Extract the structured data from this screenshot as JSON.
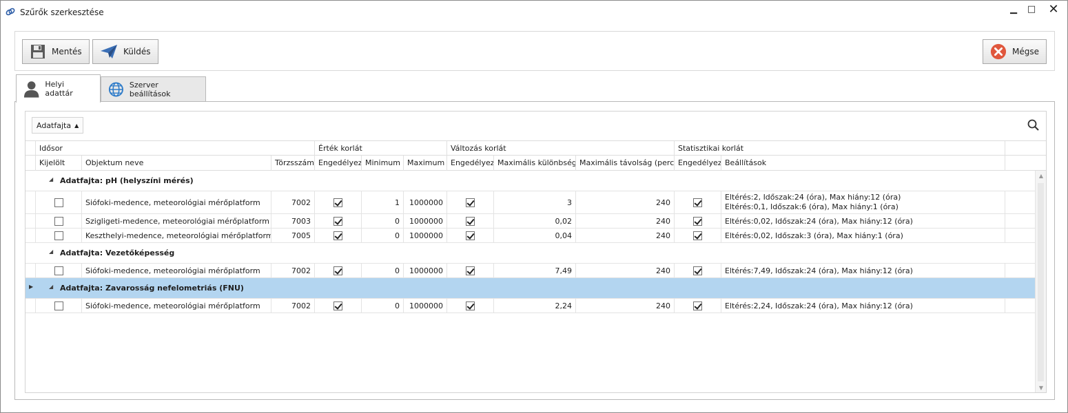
{
  "window": {
    "title": "Szűrők szerkesztése",
    "icons": {
      "app": "filter-chain-icon",
      "minimize": "minimize-icon",
      "maximize": "maximize-icon",
      "close": "close-icon"
    }
  },
  "toolbar": {
    "save_label": "Mentés",
    "send_label": "Küldés",
    "cancel_label": "Mégse",
    "icons": {
      "save": "floppy-disk-icon",
      "send": "paper-plane-icon",
      "cancel": "cancel-x-icon"
    }
  },
  "tabs": [
    {
      "label": "Helyi adattár",
      "icon": "user-icon",
      "active": true
    },
    {
      "label": "Szerver beállítások",
      "icon": "globe-icon",
      "active": false
    }
  ],
  "grid": {
    "group_chip": "Adatfajta",
    "band_headers": {
      "series": "Idősor",
      "value_limit": "Érték korlát",
      "change_limit": "Változás korlát",
      "stat_limit": "Statisztikai korlát"
    },
    "columns": {
      "selected": "Kijelölt",
      "object_name": "Objektum neve",
      "station_id": "Törzsszám",
      "value_enabled": "Engedélyez",
      "minimum": "Minimum",
      "maximum": "Maximum",
      "change_enabled": "Engedélyez",
      "max_diff": "Maximális különbség",
      "max_dist": "Maximális távolság (perc)",
      "stat_enabled": "Engedélyez",
      "settings": "Beállítások"
    },
    "groups": [
      {
        "label": "Adatfajta: pH (helyszíni mérés)",
        "selected": false,
        "rows": [
          {
            "selected": false,
            "object_name": "Siófoki-medence, meteorológiai mérőplatform",
            "station_id": "7002",
            "value_enabled": true,
            "minimum": "1",
            "maximum": "1000000",
            "change_enabled": true,
            "max_diff": "3",
            "max_dist": "240",
            "stat_enabled": true,
            "settings": [
              "Eltérés:2, Időszak:24 (óra), Max hiány:12 (óra)",
              "Eltérés:0,1, Időszak:6 (óra), Max hiány:1 (óra)"
            ]
          },
          {
            "selected": false,
            "object_name": "Szigligeti-medence, meteorológiai mérőplatform",
            "station_id": "7003",
            "value_enabled": true,
            "minimum": "0",
            "maximum": "1000000",
            "change_enabled": true,
            "max_diff": "0,02",
            "max_dist": "240",
            "stat_enabled": true,
            "settings": [
              "Eltérés:0,02, Időszak:24 (óra), Max hiány:12 (óra)"
            ]
          },
          {
            "selected": false,
            "object_name": "Keszthelyi-medence, meteorológiai mérőplatform",
            "station_id": "7005",
            "value_enabled": true,
            "minimum": "0",
            "maximum": "1000000",
            "change_enabled": true,
            "max_diff": "0,04",
            "max_dist": "240",
            "stat_enabled": true,
            "settings": [
              "Eltérés:0,02, Időszak:3 (óra), Max hiány:1 (óra)"
            ]
          }
        ]
      },
      {
        "label": "Adatfajta: Vezetőképesség",
        "selected": false,
        "rows": [
          {
            "selected": false,
            "object_name": "Siófoki-medence, meteorológiai mérőplatform",
            "station_id": "7002",
            "value_enabled": true,
            "minimum": "0",
            "maximum": "1000000",
            "change_enabled": true,
            "max_diff": "7,49",
            "max_dist": "240",
            "stat_enabled": true,
            "settings": [
              "Eltérés:7,49, Időszak:24 (óra), Max hiány:12 (óra)"
            ]
          }
        ]
      },
      {
        "label": "Adatfajta: Zavarosság nefelometriás (FNU)",
        "selected": true,
        "rows": [
          {
            "selected": false,
            "object_name": "Siófoki-medence, meteorológiai mérőplatform",
            "station_id": "7002",
            "value_enabled": true,
            "minimum": "0",
            "maximum": "1000000",
            "change_enabled": true,
            "max_diff": "2,24",
            "max_dist": "240",
            "stat_enabled": true,
            "settings": [
              "Eltérés:2,24, Időszak:24 (óra), Max hiány:12 (óra)"
            ]
          }
        ]
      }
    ]
  },
  "colors": {
    "selected_row": "#b3d5f0",
    "cancel_icon": "#e0573d",
    "send_icon": "#3b6fb6",
    "globe_icon": "#2f7cc9"
  }
}
